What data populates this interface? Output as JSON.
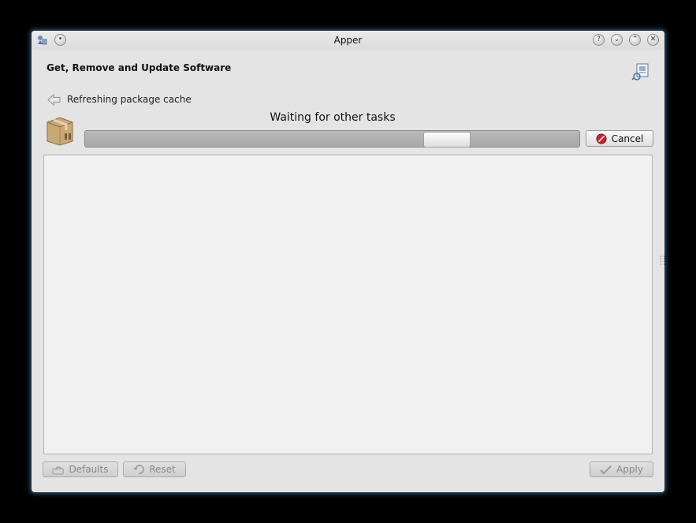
{
  "window": {
    "title": "Apper"
  },
  "titlebar": {
    "app_icon": "apper-icon",
    "menu_button": "circle-icon",
    "buttons": [
      "help-icon",
      "minimize-icon",
      "maximize-icon",
      "close-icon"
    ],
    "help_glyph": "?",
    "minimize_glyph": "⌄",
    "maximize_glyph": "⌃",
    "close_glyph": "✕"
  },
  "header": {
    "title": "Get, Remove and Update Software",
    "icon": "software-settings-icon"
  },
  "transaction": {
    "back_icon": "arrow-left-icon",
    "task_label": "Refreshing package cache",
    "package_icon": "package-box-icon",
    "status_text": "Waiting for other tasks",
    "progress_mode": "indeterminate",
    "cancel_label": "Cancel"
  },
  "footer": {
    "defaults_label": "Defaults",
    "reset_label": "Reset",
    "apply_label": "Apply"
  },
  "colors": {
    "accent_glow": "#5096c8",
    "cancel_red": "#d0202a"
  }
}
